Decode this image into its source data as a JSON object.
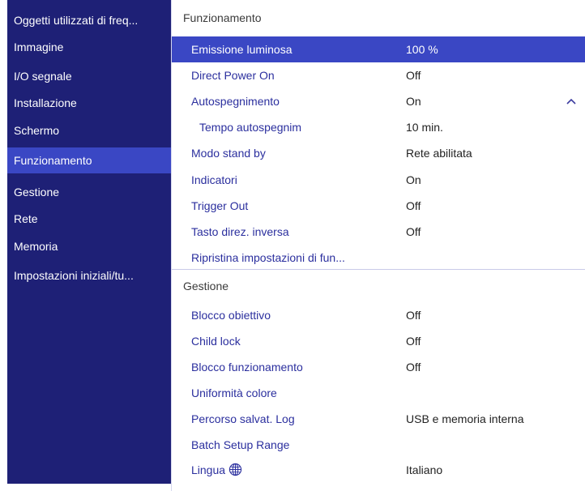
{
  "sidebar": {
    "items": [
      {
        "label": "Oggetti utilizzati di freq..."
      },
      {
        "label": "Immagine"
      },
      {
        "label": "I/O segnale"
      },
      {
        "label": "Installazione"
      },
      {
        "label": "Schermo"
      },
      {
        "label": "Funzionamento",
        "active": true
      },
      {
        "label": "Gestione"
      },
      {
        "label": "Rete"
      },
      {
        "label": "Memoria"
      },
      {
        "label": "Impostazioni iniziali/tu..."
      }
    ]
  },
  "sections": {
    "funzionamento": {
      "title": "Funzionamento",
      "rows": [
        {
          "label": "Emissione luminosa",
          "value": "100 %"
        },
        {
          "label": "Direct Power On",
          "value": "Off"
        },
        {
          "label": "Autospegnimento",
          "value": "On"
        },
        {
          "label": "Tempo autospegnim",
          "value": "10 min."
        },
        {
          "label": "Modo stand by",
          "value": "Rete abilitata"
        },
        {
          "label": "Indicatori",
          "value": "On"
        },
        {
          "label": "Trigger Out",
          "value": "Off"
        },
        {
          "label": "Tasto direz. inversa",
          "value": "Off"
        },
        {
          "label": "Ripristina impostazioni di fun...",
          "value": ""
        }
      ]
    },
    "gestione": {
      "title": "Gestione",
      "rows": [
        {
          "label": "Blocco obiettivo",
          "value": "Off"
        },
        {
          "label": "Child lock",
          "value": "Off"
        },
        {
          "label": "Blocco funzionamento",
          "value": "Off"
        },
        {
          "label": "Uniformità colore",
          "value": ""
        },
        {
          "label": "Percorso salvat. Log",
          "value": "USB e memoria interna"
        },
        {
          "label": "Batch Setup Range",
          "value": ""
        },
        {
          "label": "Lingua",
          "value": "Italiano"
        }
      ]
    }
  },
  "icons": {
    "collapse": "chevron-up-icon",
    "language": "globe-icon"
  },
  "colors": {
    "sidebar_bg": "#1e2076",
    "selected_bg": "#3a47c4",
    "item_text": "#2b2f9e"
  }
}
